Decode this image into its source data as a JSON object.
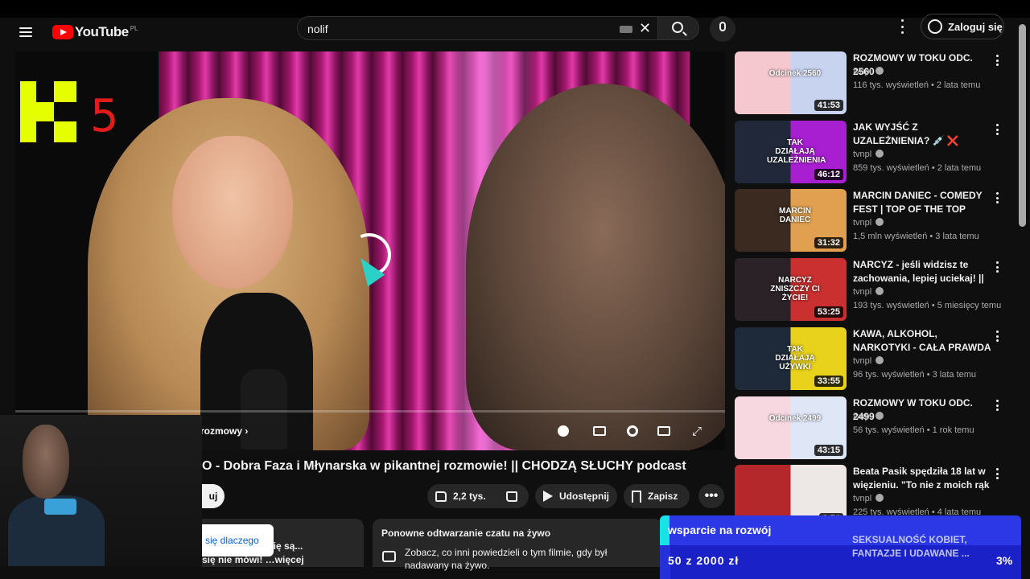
{
  "header": {
    "logo_text": "YouTube",
    "logo_sup": "PL",
    "search_value": "nolif",
    "clear_icon": "✕",
    "signin_label": "Zaloguj się"
  },
  "player": {
    "channel_logo_number": "5",
    "chapter_label": "rozmowy",
    "controls": [
      "pause-icon",
      "subtitles-icon",
      "settings-icon",
      "theater-icon",
      "fullscreen-icon"
    ]
  },
  "video": {
    "title": "O - Dobra Faza i Młynarska w pikantnej rozmowie! || CHODZĄ SŁUCHY podcast",
    "subscribe_fragment": "uj",
    "likes": "2,2 tys.",
    "share_label": "Udostępnij",
    "save_label": "Zapisz",
    "tooltip_text": "się dlaczego",
    "desc_line1": "…ę się są...",
    "desc_line2": "się nie mówi! …więcej"
  },
  "replay": {
    "title": "Ponowne odtwarzanie czatu na żywo",
    "description": "Zobacz, co inni powiedzieli o tym filmie, gdy był nadawany na żywo."
  },
  "recommendations": [
    {
      "title": "ROZMOWY W TOKU ODC. 2560",
      "channel": "tvnpl",
      "meta": "116 tys. wyświetleń • 2 lata temu",
      "duration": "41:53",
      "thumb_text": "Odcinek 2560",
      "colors": [
        "#f5c7cf",
        "#c8d3ef"
      ]
    },
    {
      "title": "JAK WYJŚĆ Z UZALEŻNIENIA? 💉 ❌ Historia Mestosława i ...",
      "channel": "tvnpl",
      "meta": "859 tys. wyświetleń • 2 lata temu",
      "duration": "46:12",
      "thumb_text": "TAK DZIAŁAJĄ UZALEŻNIENIA",
      "colors": [
        "#20283a",
        "#a71fd0"
      ]
    },
    {
      "title": "MARCIN DANIEC - COMEDY FEST | TOP OF THE TOP SOPO...",
      "channel": "tvnpl",
      "meta": "1,5 mln wyświetleń • 3 lata temu",
      "duration": "31:32",
      "thumb_text": "MARCIN DANIEC",
      "colors": [
        "#3a2a20",
        "#e0a050"
      ]
    },
    {
      "title": "NARCYZ - jeśli widzisz te zachowania, lepiej uciekaj! || ...",
      "channel": "tvnpl",
      "meta": "193 tys. wyświetleń • 5 miesięcy temu",
      "duration": "53:25",
      "thumb_text": "NARCYZ ZNISZCZY CI ŻYCIE!",
      "colors": [
        "#2a2226",
        "#c9302f"
      ]
    },
    {
      "title": "KAWA, ALKOHOL, NARKOTYKI - CAŁA PRAWDA O ...",
      "channel": "tvnpl",
      "meta": "96 tys. wyświetleń • 3 lata temu",
      "duration": "33:55",
      "thumb_text": "TAK DZIAŁAJĄ UŻYWKI",
      "colors": [
        "#1e2a3a",
        "#e9d21b"
      ]
    },
    {
      "title": "ROZMOWY W TOKU ODC. 2499",
      "channel": "tvnpl",
      "meta": "56 tys. wyświetleń • 1 rok temu",
      "duration": "43:15",
      "thumb_text": "Odcinek 2499",
      "colors": [
        "#f7d8e0",
        "#dfe7f7"
      ]
    },
    {
      "title": "Beata Pasik spędziła 18 lat w więzieniu. \"To nie z moich rąk ...",
      "channel": "tvnpl",
      "meta": "225 tys. wyświetleń • 4 lata temu",
      "duration": "8:54",
      "thumb_text": "",
      "colors": [
        "#b4282c",
        "#ede8e6"
      ]
    }
  ],
  "donation": {
    "label": "wsparcie na rozwój",
    "amount": "50 z 2000 zł",
    "percent": "3%",
    "progress": 0.03,
    "ghost_title": "SEKSUALNOŚĆ KOBIET, FANTAZJE I UDAWANE ..."
  },
  "colors": {
    "accent_red": "#ff0000",
    "k5_yellow": "#e6ff00",
    "donation_blue": "#1a22c7",
    "cursor_cyan": "#2bd1c4"
  }
}
